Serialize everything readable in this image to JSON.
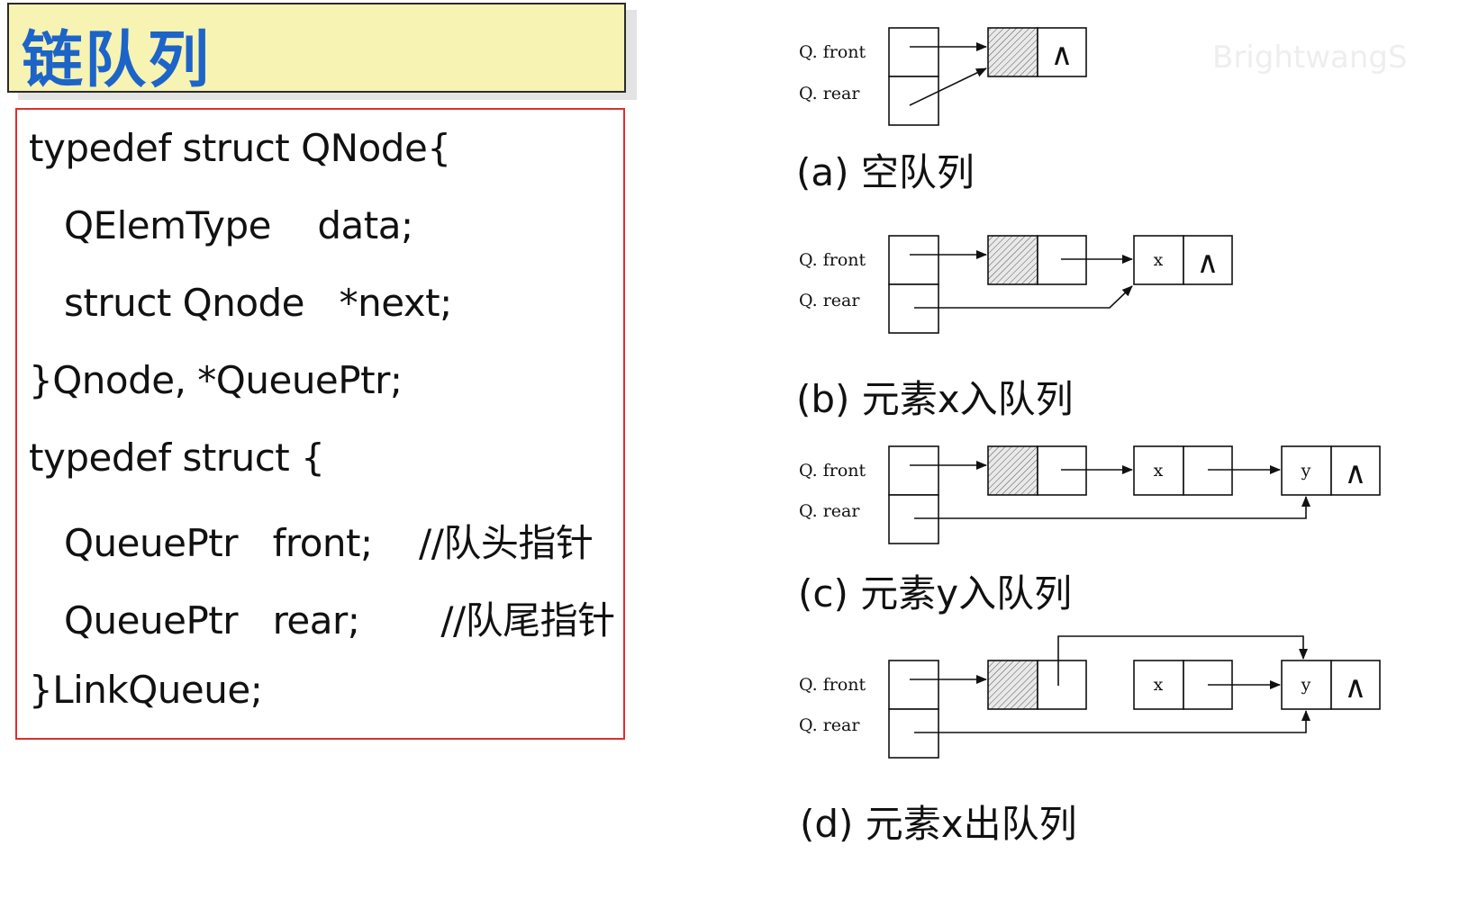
{
  "title": "链队列",
  "code_lines": [
    "typedef struct QNode{",
    "QElemType    data;",
    "struct Qnode   *next;",
    "}Qnode, *QueuePtr;",
    "typedef struct {",
    "QueuePtr   front;    //队头指针",
    "QueuePtr   rear;       //队尾指针",
    "}LinkQueue;"
  ],
  "labels": {
    "front": "Q. front",
    "rear": "Q. rear"
  },
  "nil_symbol": "∧",
  "node_values": {
    "x": "x",
    "y": "y"
  },
  "captions": [
    "(a) 空队列",
    "(b) 元素x入队列",
    "(c) 元素y入队列",
    "(d) 元素x出队列"
  ],
  "watermark": "BrightwangS",
  "colors": {
    "title_bg": "#f6f3b3",
    "title_text": "#1d64c9",
    "code_border": "#e02d2d"
  }
}
